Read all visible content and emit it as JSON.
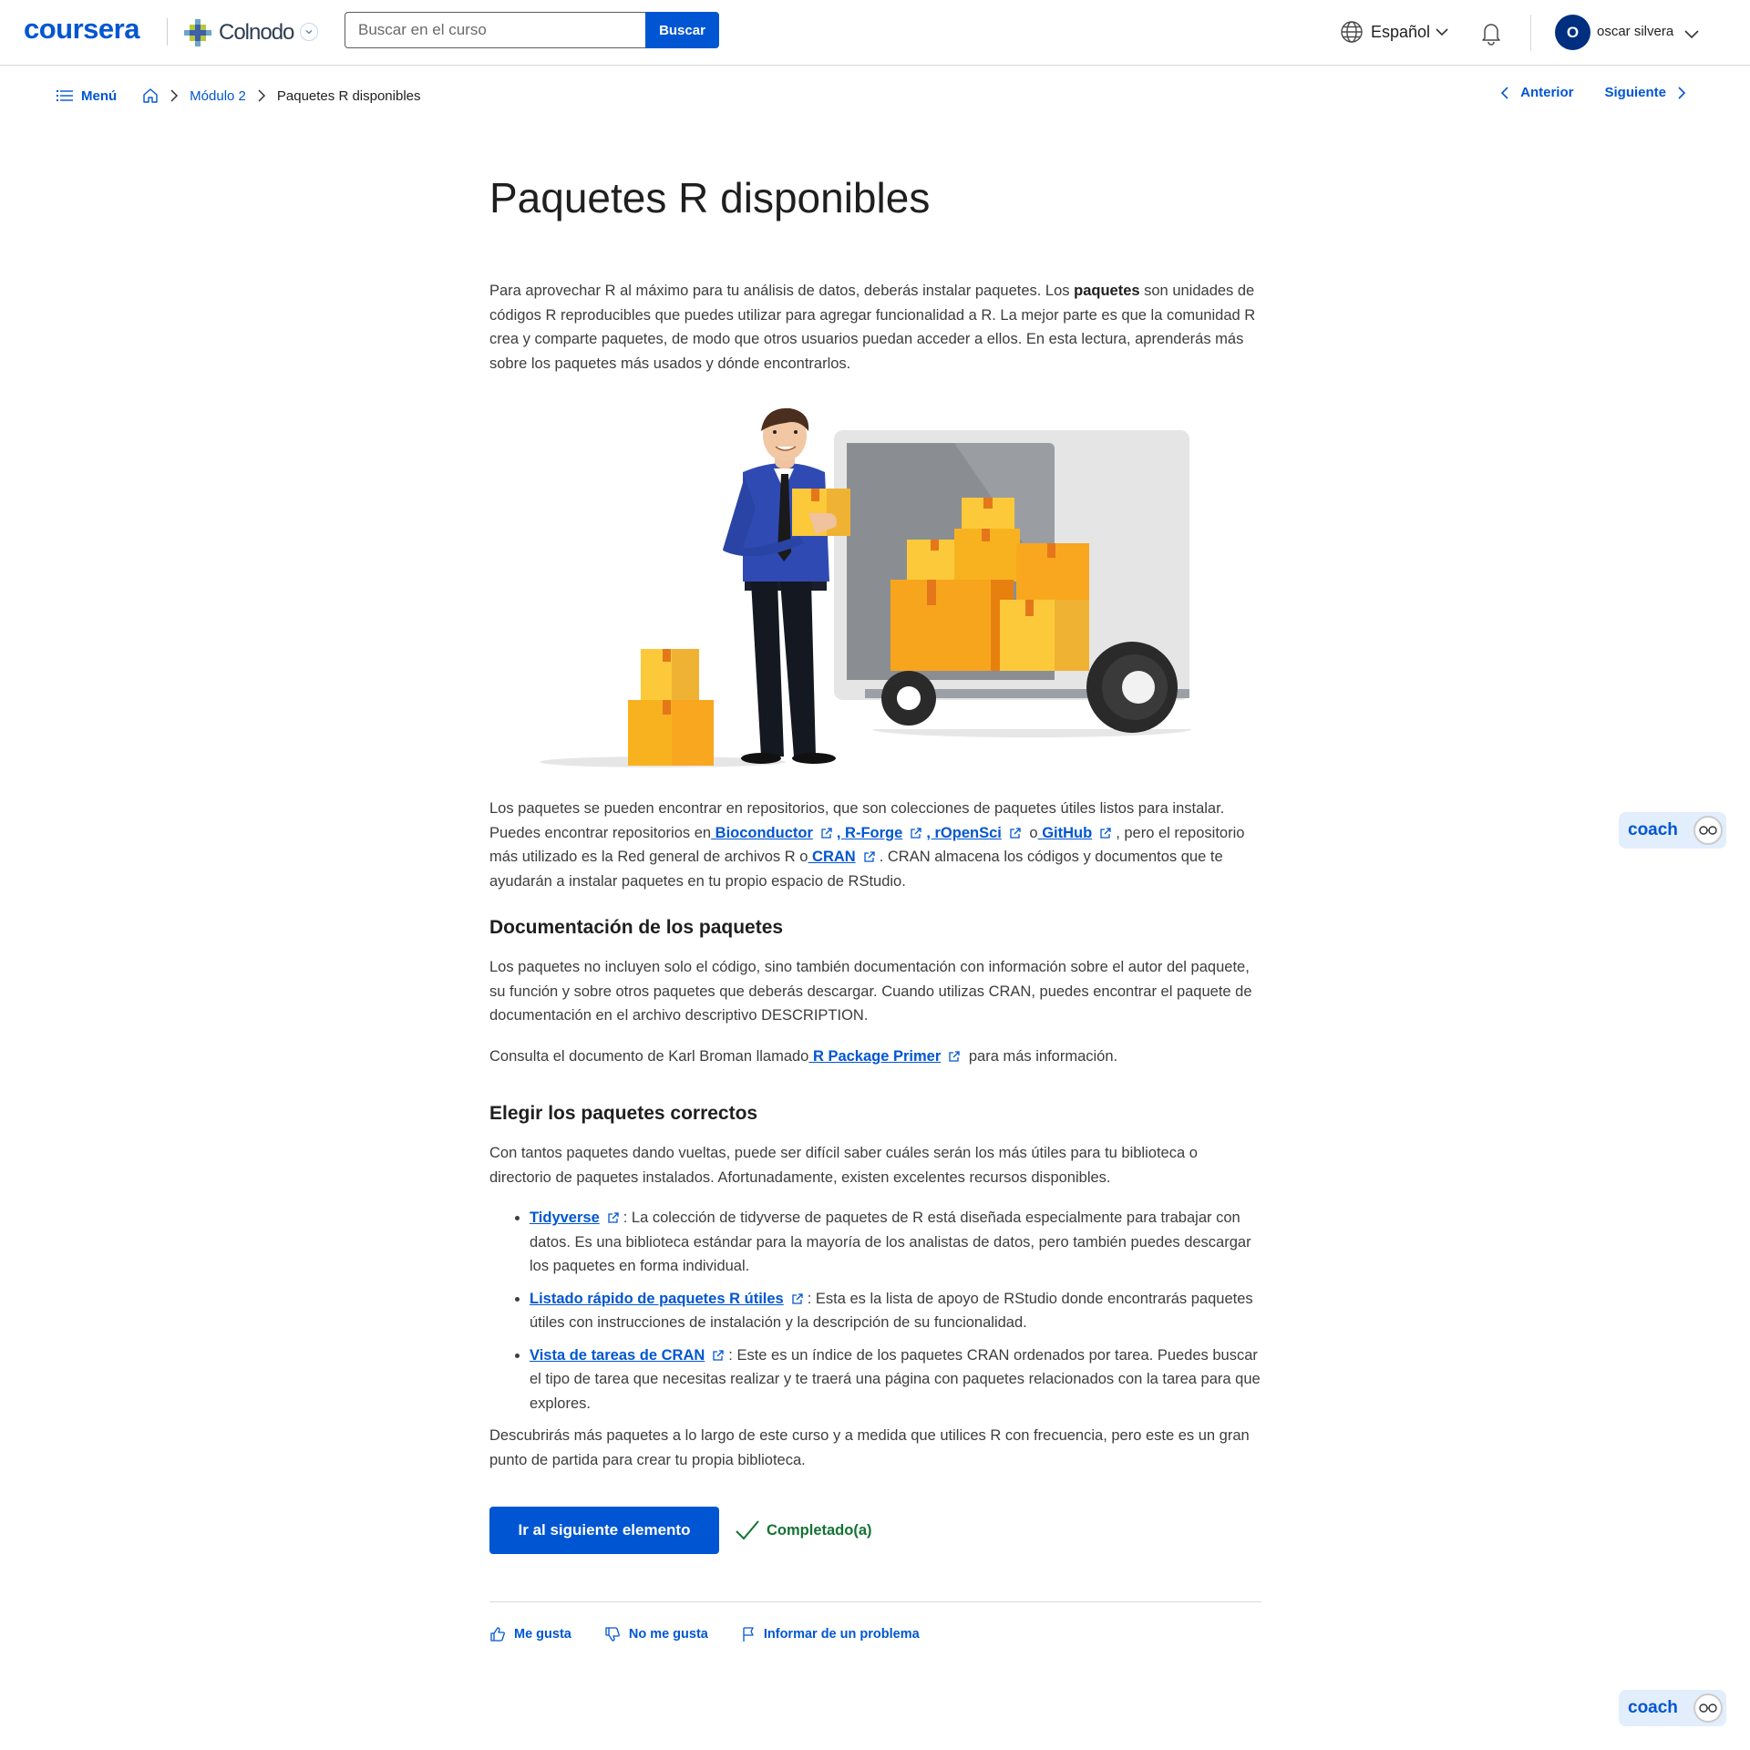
{
  "header": {
    "logo": "coursera",
    "partner": "Colnodo",
    "search": {
      "placeholder": "Buscar en el curso",
      "button": "Buscar"
    },
    "language": "Español",
    "user": {
      "initial": "O",
      "name": "oscar silvera"
    }
  },
  "breadcrumb": {
    "menu": "Menú",
    "module": "Módulo 2",
    "current": "Paquetes R disponibles"
  },
  "pager": {
    "prev": "Anterior",
    "next": "Siguiente"
  },
  "article": {
    "title": "Paquetes R disponibles",
    "intro_a": "Para aprovechar R al máximo para tu análisis de datos, deberás instalar paquetes. Los ",
    "intro_bold": "paquetes",
    "intro_b": " son unidades de códigos R reproducibles que puedes utilizar para agregar funcionalidad a R. La mejor parte es que la comunidad R crea y comparte paquetes, de modo que otros usuarios puedan acceder a ellos. En esta lectura, aprenderás más sobre los paquetes más usados y dónde encontrarlos.",
    "repos_a": "Los paquetes se pueden encontrar en repositorios, que son colecciones de paquetes útiles listos para instalar. Puedes encontrar repositorios en",
    "link_bioconductor": " Bioconductor",
    "link_rforge": ", R-Forge",
    "link_ropensci": ", rOpenSci",
    "repos_o": " o",
    "link_github": " GitHub",
    "repos_b": ", pero el repositorio más utilizado es la Red general de archivos R o",
    "link_cran": " CRAN",
    "repos_c": ". CRAN almacena los códigos y documentos que te ayudarán a instalar paquetes en tu propio espacio de RStudio.",
    "h_doc": "Documentación de los paquetes",
    "doc_p": "Los paquetes no incluyen solo el código, sino también documentación con información sobre el autor del paquete, su función y sobre otros paquetes que deberás descargar. Cuando utilizas CRAN, puedes encontrar el paquete de documentación en el archivo descriptivo DESCRIPTION.",
    "primer_a": "Consulta el documento de Karl Broman llamado",
    "link_primer": " R Package Primer",
    "primer_b": " para más información.",
    "h_choose": "Elegir los paquetes correctos",
    "choose_p": "Con tantos paquetes dando vueltas, puede ser difícil saber cuáles serán los más útiles para tu biblioteca o directorio de paquetes instalados. Afortunadamente, existen excelentes recursos disponibles.",
    "list": [
      {
        "link": "Tidyverse",
        "text": ": La colección de tidyverse de paquetes de R está diseñada especialmente para trabajar con datos. Es una biblioteca estándar para la mayoría de los analistas de datos, pero también puedes descargar los paquetes en forma individual."
      },
      {
        "link": "Listado rápido de paquetes R útiles",
        "text": ": Esta es la lista de apoyo de RStudio donde encontrarás paquetes útiles con instrucciones de instalación y la descripción de su funcionalidad."
      },
      {
        "link": "Vista de tareas de CRAN",
        "text": ": Este es un índice de los paquetes CRAN ordenados por tarea. Puedes buscar el tipo de tarea que necesitas realizar y te traerá una página con paquetes relacionados con la tarea para que explores."
      }
    ],
    "closing": "Descubrirás más paquetes a lo largo de este curso y a medida que utilices R con frecuencia, pero este es un gran punto de partida para crear tu propia biblioteca."
  },
  "actions": {
    "next": "Ir al siguiente elemento",
    "completed": "Completado(a)"
  },
  "feedback": {
    "like": "Me gusta",
    "dislike": "No me gusta",
    "report": "Informar de un problema"
  },
  "coach": {
    "label": "coach"
  },
  "colors": {
    "brand": "#0056d2",
    "success": "#137333",
    "avatar": "#002f80"
  }
}
